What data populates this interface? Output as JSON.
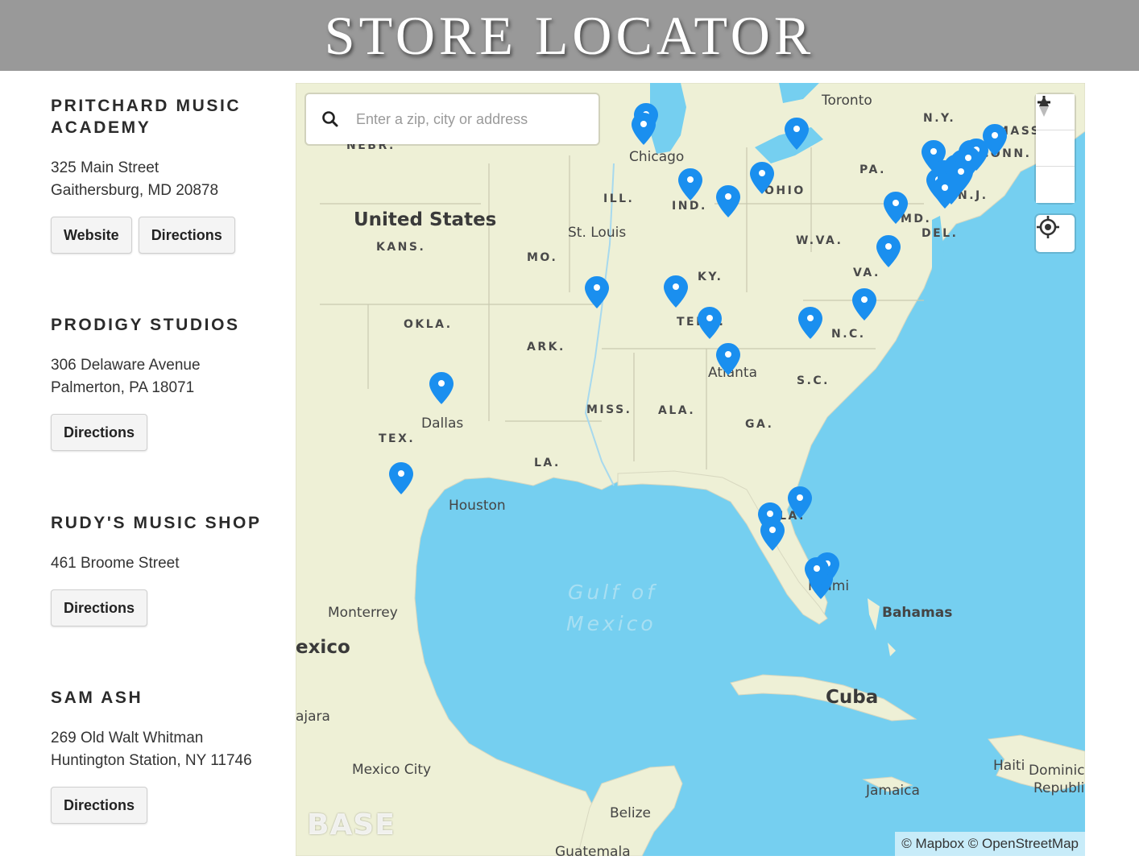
{
  "header": {
    "title": "STORE LOCATOR"
  },
  "stores": [
    {
      "name": "PRITCHARD MUSIC ACADEMY",
      "address_line1": "325 Main Street",
      "address_line2": "Gaithersburg, MD 20878",
      "buttons": [
        "Website",
        "Directions"
      ]
    },
    {
      "name": "PRODIGY STUDIOS",
      "address_line1": "306 Delaware Avenue",
      "address_line2": "Palmerton, PA 18071",
      "buttons": [
        "Directions"
      ]
    },
    {
      "name": "RUDY'S MUSIC SHOP",
      "address_line1": "461 Broome Street",
      "address_line2": "",
      "buttons": [
        "Directions"
      ]
    },
    {
      "name": "SAM ASH",
      "address_line1": "269 Old Walt Whitman",
      "address_line2": "Huntington Station, NY 11746",
      "buttons": [
        "Directions"
      ]
    }
  ],
  "map": {
    "search_placeholder": "Enter a zip, city or address",
    "zoom_in": "+",
    "zoom_out": "−",
    "attribution": "© Mapbox © OpenStreetMap",
    "logo": "BASE",
    "icons": [
      "search-icon",
      "plus-icon",
      "minus-icon",
      "compass-icon",
      "geolocate-icon",
      "map-pin-icon"
    ],
    "colors": {
      "water": "#75cff0",
      "land": "#eef0d6",
      "pin": "#1a8fef"
    },
    "labels": {
      "countries": [
        "United States",
        "Cuba",
        "Bahamas",
        "exico"
      ],
      "states": [
        "NEBR.",
        "ILL.",
        "IND.",
        "OHIO",
        "PA.",
        "N.Y.",
        "MASS.",
        "CONN.",
        "N.J.",
        "MD.",
        "DEL.",
        "W.VA.",
        "VA.",
        "KY.",
        "KANS.",
        "MO.",
        "OKLA.",
        "ARK.",
        "TENN.",
        "N.C.",
        "S.C.",
        "GA.",
        "ALA.",
        "MISS.",
        "LA.",
        "TEX.",
        "FLA."
      ],
      "cities": [
        "Toronto",
        "Chicago",
        "St. Louis",
        "Atlanta",
        "Dallas",
        "Houston",
        "Miami",
        "Monterrey",
        "ajara",
        "Mexico City",
        "Belize",
        "Guatemala",
        "Jamaica",
        "Haiti",
        "Dominica",
        "Republic"
      ],
      "water": [
        "Gulf of",
        "Mexico"
      ]
    }
  }
}
